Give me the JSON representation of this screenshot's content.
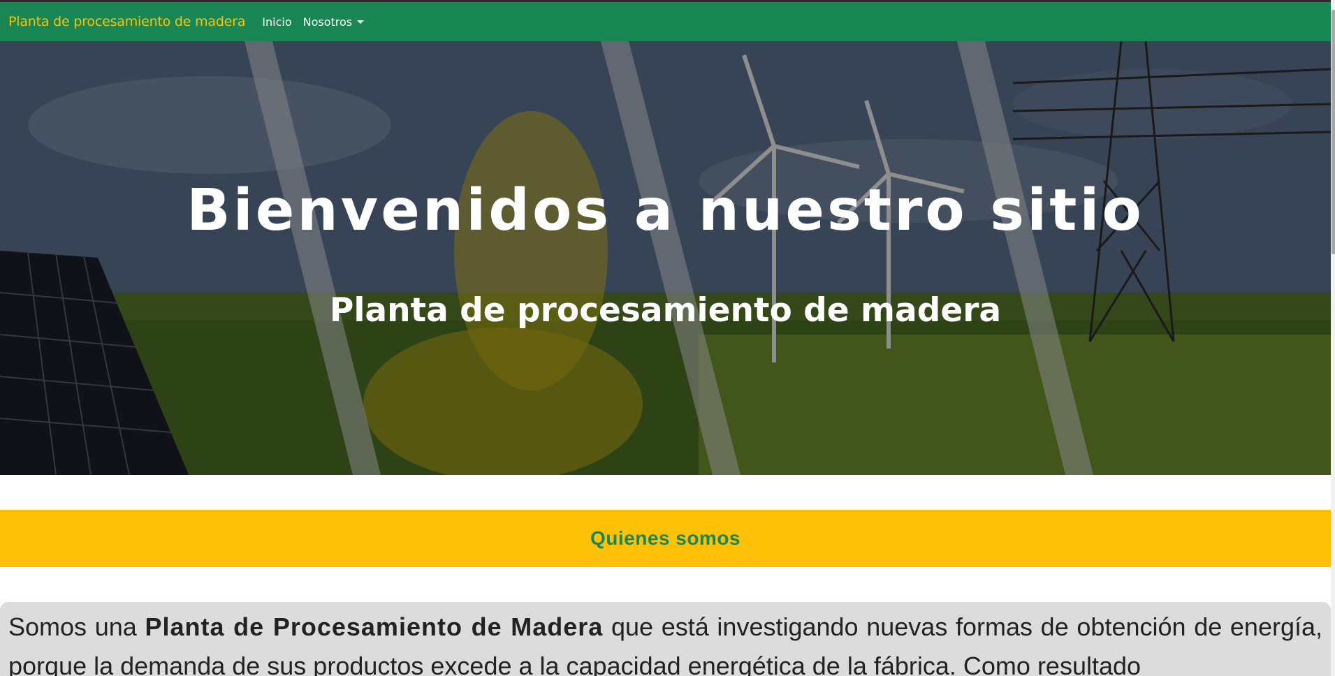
{
  "navbar": {
    "brand": "Planta de procesamiento de madera",
    "links": [
      {
        "label": "Inicio"
      },
      {
        "label": "Nosotros",
        "dropdown": true
      }
    ]
  },
  "hero": {
    "title": "Bienvenidos a nuestro sitio",
    "subtitle": "Planta de procesamiento de madera"
  },
  "section": {
    "title": "Quienes somos"
  },
  "about": {
    "lead": "Somos una ",
    "bold": "Planta de Procesamiento de Madera",
    "rest": " que está investigando nuevas formas de obtención de energía, porque la demanda de sus productos excede a la capacidad energética de la fábrica. Como resultado"
  },
  "colors": {
    "navbar_bg": "#198754",
    "brand": "#ffc107",
    "section_bg": "#ffc107",
    "section_text": "#198754",
    "about_bg": "#dcdcdc"
  },
  "icons": {
    "dropdown": "chevron-down-icon"
  }
}
